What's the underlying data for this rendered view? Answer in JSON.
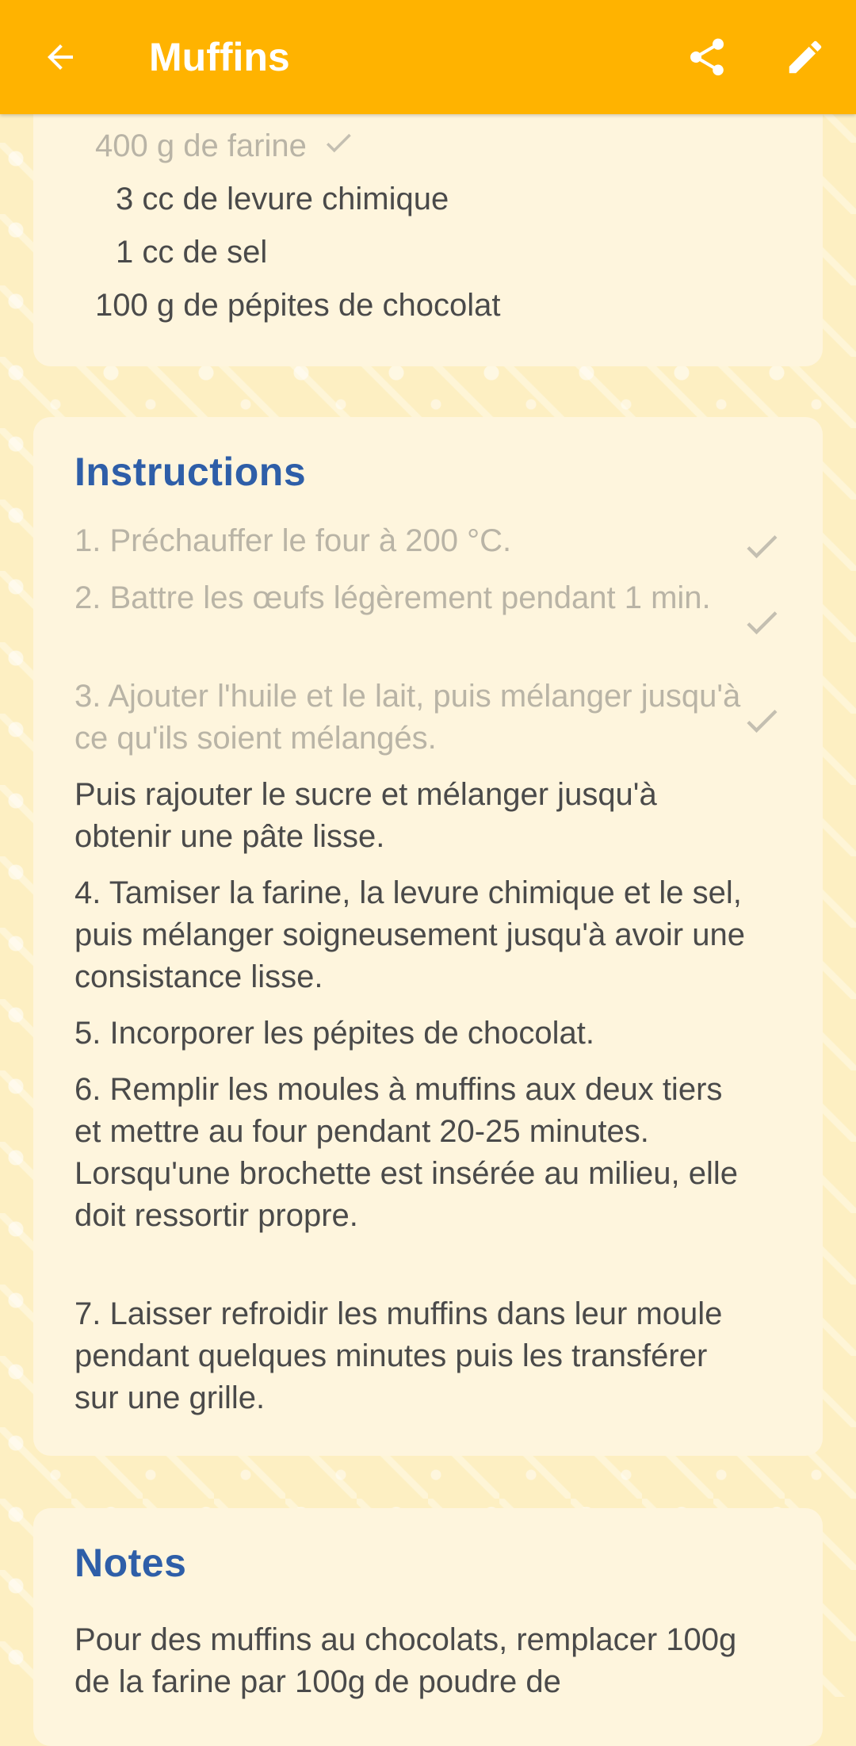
{
  "appbar": {
    "title": "Muffins",
    "back_icon": "arrow-back-icon",
    "share_icon": "share-icon",
    "edit_icon": "pencil-icon",
    "color": "#ffb300"
  },
  "ingredients": [
    {
      "text": "400 g de farine",
      "done": true
    },
    {
      "text": "3 cc de levure chimique",
      "done": false
    },
    {
      "text": "1 cc de sel",
      "done": false
    },
    {
      "text": "100 g de pépites de chocolat",
      "done": false
    }
  ],
  "instructions": {
    "title": "Instructions",
    "steps": [
      {
        "text": "1. Préchauffer le four à 200 °C.",
        "done": true
      },
      {
        "text": "2. Battre les œufs légèrement pendant 1 min.",
        "done": true
      },
      {
        "text": "3. Ajouter l'huile et le lait, puis mélanger jusqu'à ce qu'ils soient mélangés.",
        "done": true
      },
      {
        "text": "Puis rajouter le sucre et mélanger jusqu'à obtenir une pâte lisse.",
        "done": false
      },
      {
        "text": "4. Tamiser la farine, la levure chimique et le sel, puis mélanger soigneusement jusqu'à avoir une consistance lisse.",
        "done": false
      },
      {
        "text": "5. Incorporer les pépites de chocolat.",
        "done": false
      },
      {
        "text": "6. Remplir les moules à muffins aux deux tiers et mettre au four pendant 20-25 minutes. Lorsqu'une brochette est insérée au milieu, elle doit ressortir propre.",
        "done": false
      },
      {
        "text": "7. Laisser refroidir les muffins dans leur moule pendant quelques minutes puis les transférer sur une grille.",
        "done": false
      }
    ]
  },
  "notes": {
    "title": "Notes",
    "text": "Pour des muffins au chocolats, remplacer 100g de la farine par 100g de poudre de"
  },
  "colors": {
    "accent": "#ffb300",
    "section_title": "#2e5ea8",
    "text": "#4a4a4a",
    "done_text": "#b9b4a6",
    "card": "#fef5dd",
    "background": "#fdefc2"
  }
}
